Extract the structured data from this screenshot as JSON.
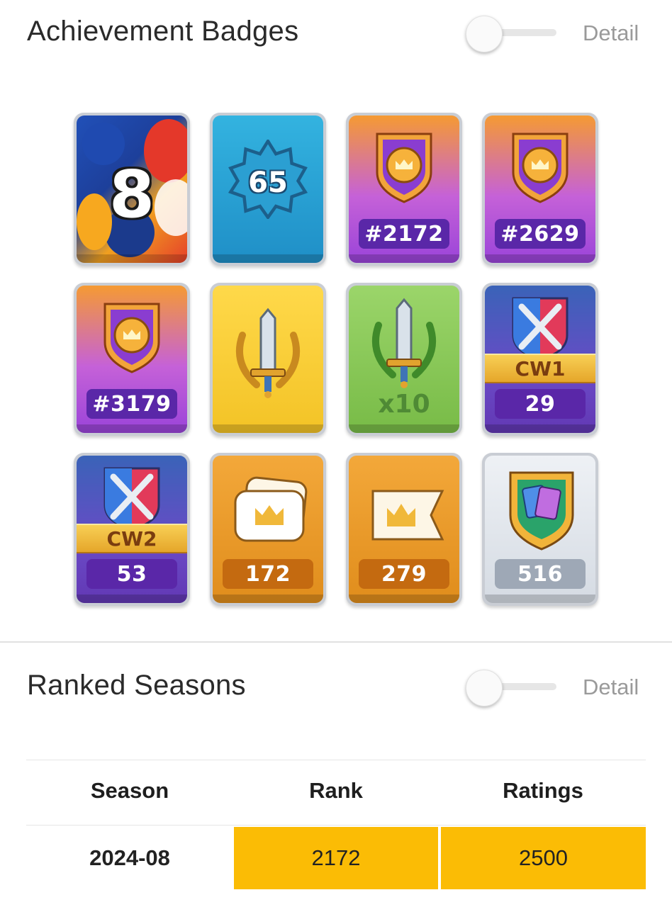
{
  "achievement_section": {
    "title": "Achievement Badges",
    "detail_label": "Detail",
    "toggle_on": false
  },
  "badges": [
    {
      "id": "anniversary",
      "big_text": "8",
      "label": ""
    },
    {
      "id": "level",
      "big_text": "65",
      "label": ""
    },
    {
      "id": "rank-1",
      "big_text": "",
      "label": "#2172"
    },
    {
      "id": "rank-2",
      "big_text": "",
      "label": "#2629"
    },
    {
      "id": "rank-3",
      "big_text": "",
      "label": "#3179"
    },
    {
      "id": "sword-gold",
      "big_text": "",
      "label": ""
    },
    {
      "id": "sword-green",
      "big_text": "x10",
      "label": ""
    },
    {
      "id": "cw1",
      "big_text": "CW1",
      "label": "29"
    },
    {
      "id": "cw2",
      "big_text": "CW2",
      "label": "53"
    },
    {
      "id": "crown-card",
      "big_text": "",
      "label": "172"
    },
    {
      "id": "crown-flag",
      "big_text": "",
      "label": "279"
    },
    {
      "id": "cards-shield",
      "big_text": "",
      "label": "516"
    }
  ],
  "ranked_section": {
    "title": "Ranked Seasons",
    "detail_label": "Detail",
    "toggle_on": false
  },
  "table": {
    "headers": [
      "Season",
      "Rank",
      "Ratings"
    ],
    "rows": [
      {
        "season": "2024-08",
        "rank": "2172",
        "ratings": "2500"
      }
    ],
    "highlight_color": "#fbbc05"
  }
}
